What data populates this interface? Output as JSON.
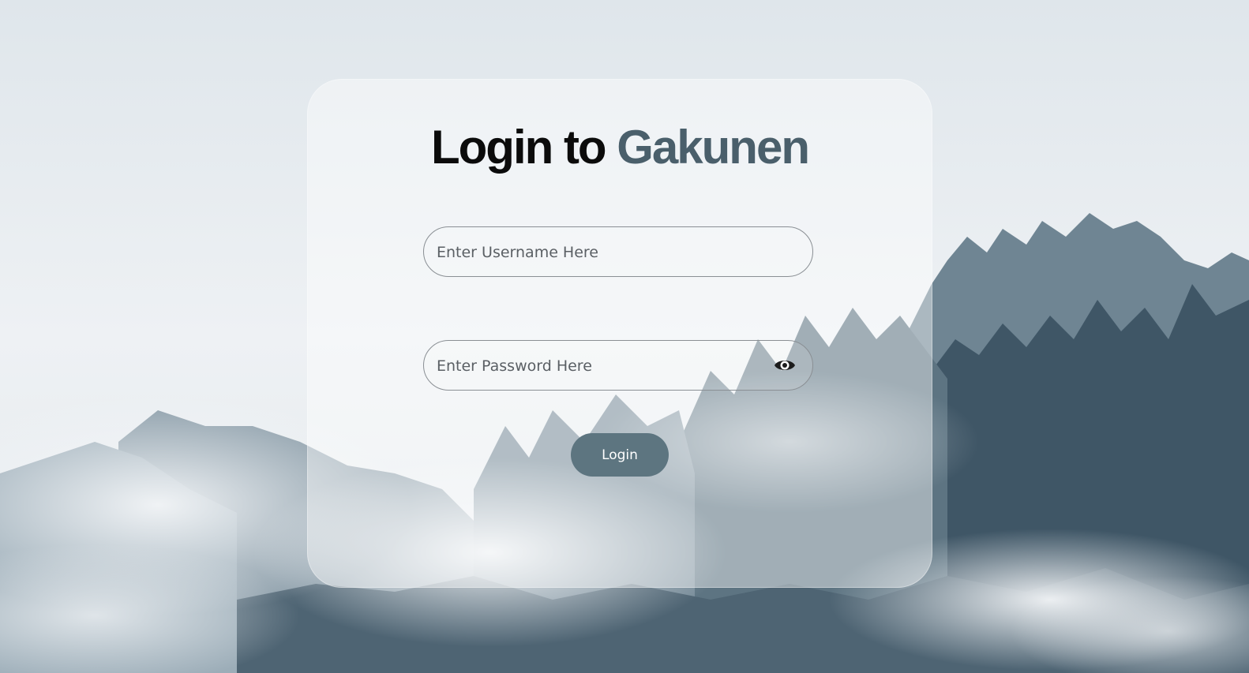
{
  "page": {
    "background": "misty-forest-background",
    "title_prefix": "Login to",
    "title_brand": "Gakunen",
    "brand_color": "#4a5f6b",
    "button_color": "#5d7580"
  },
  "login_form": {
    "username_placeholder": "Enter Username Here",
    "username_value": "",
    "password_placeholder": "Enter Password Here",
    "password_value": "",
    "toggle_icon": "eye-icon",
    "submit_label": "Login"
  }
}
